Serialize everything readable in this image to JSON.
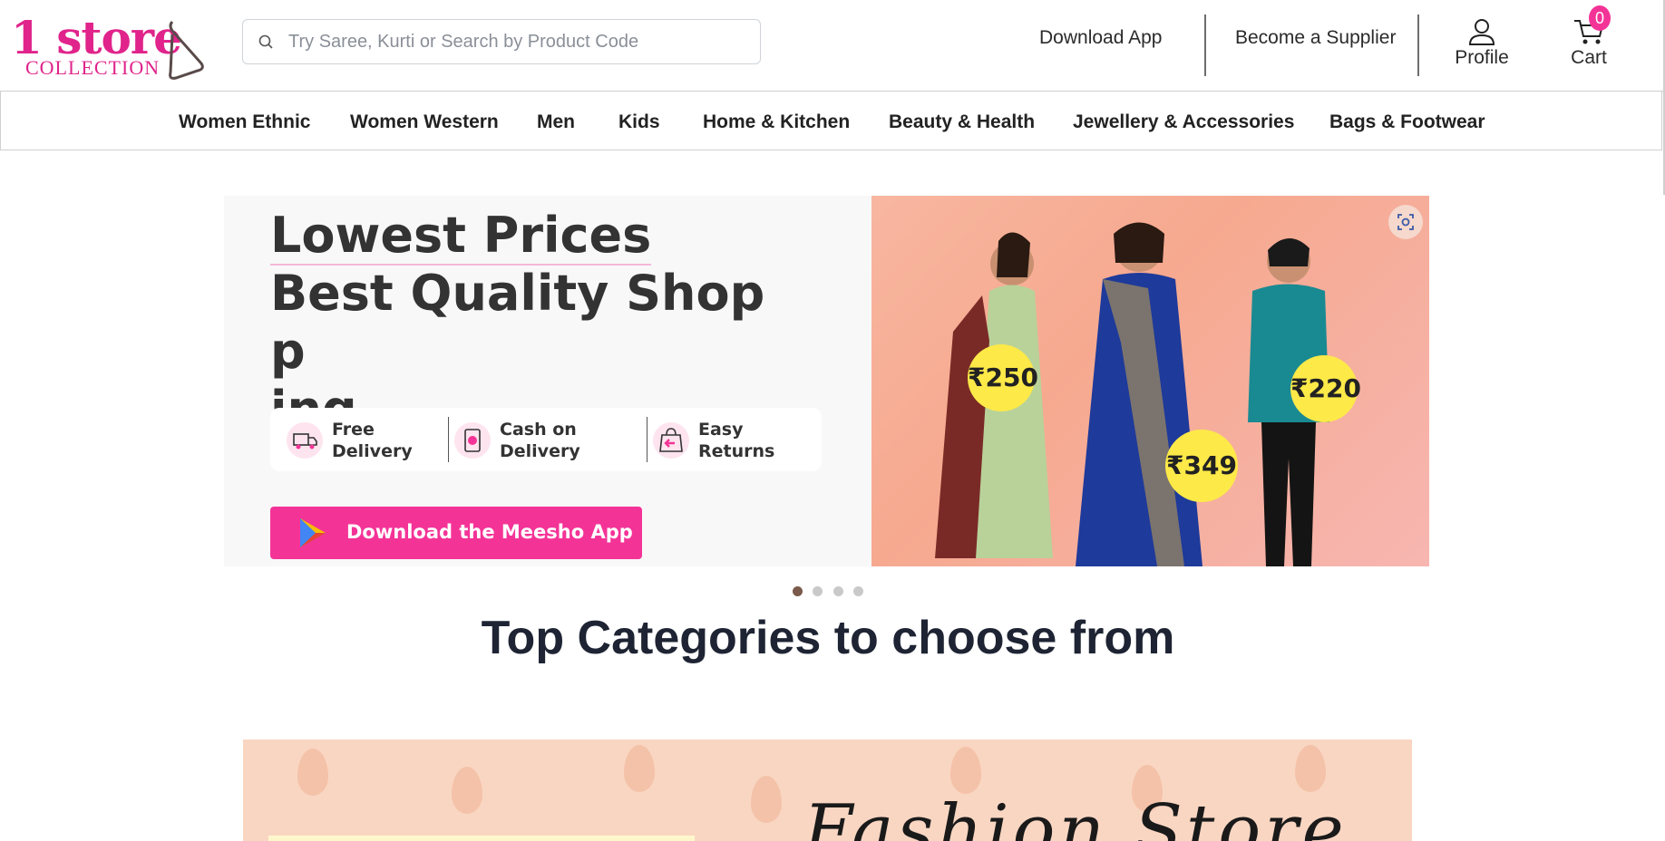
{
  "brand": {
    "logo_main": "1 store",
    "logo_sub": "COLLECTION",
    "accent_color": "#f43397",
    "logo_color": "#e0248b"
  },
  "search": {
    "placeholder": "Try Saree, Kurti or Search by Product Code",
    "value": ""
  },
  "header": {
    "download_app": "Download App",
    "become_supplier": "Become a Supplier",
    "profile": "Profile",
    "cart": "Cart",
    "cart_count": "0"
  },
  "categories": [
    "Women Ethnic",
    "Women Western",
    "Men",
    "Kids",
    "Home & Kitchen",
    "Beauty & Health",
    "Jewellery & Accessories",
    "Bags & Footwear"
  ],
  "hero": {
    "title_line1": "Lowest Prices",
    "title_line2": "Best Quality Shopp",
    "title_line3": "ing",
    "features": [
      {
        "label": "Free Delivery",
        "icon": "delivery-truck-icon"
      },
      {
        "label": "Cash on Delivery",
        "icon": "cash-icon"
      },
      {
        "label": "Easy Returns",
        "icon": "return-bag-icon"
      }
    ],
    "download_button": "Download the Meesho App",
    "prices": [
      "₹250",
      "₹349",
      "₹220"
    ]
  },
  "carousel": {
    "total_slides": 4,
    "active_slide": 1
  },
  "section": {
    "top_categories_title": "Top Categories to choose from"
  },
  "promo": {
    "text": "Fashion Store"
  }
}
